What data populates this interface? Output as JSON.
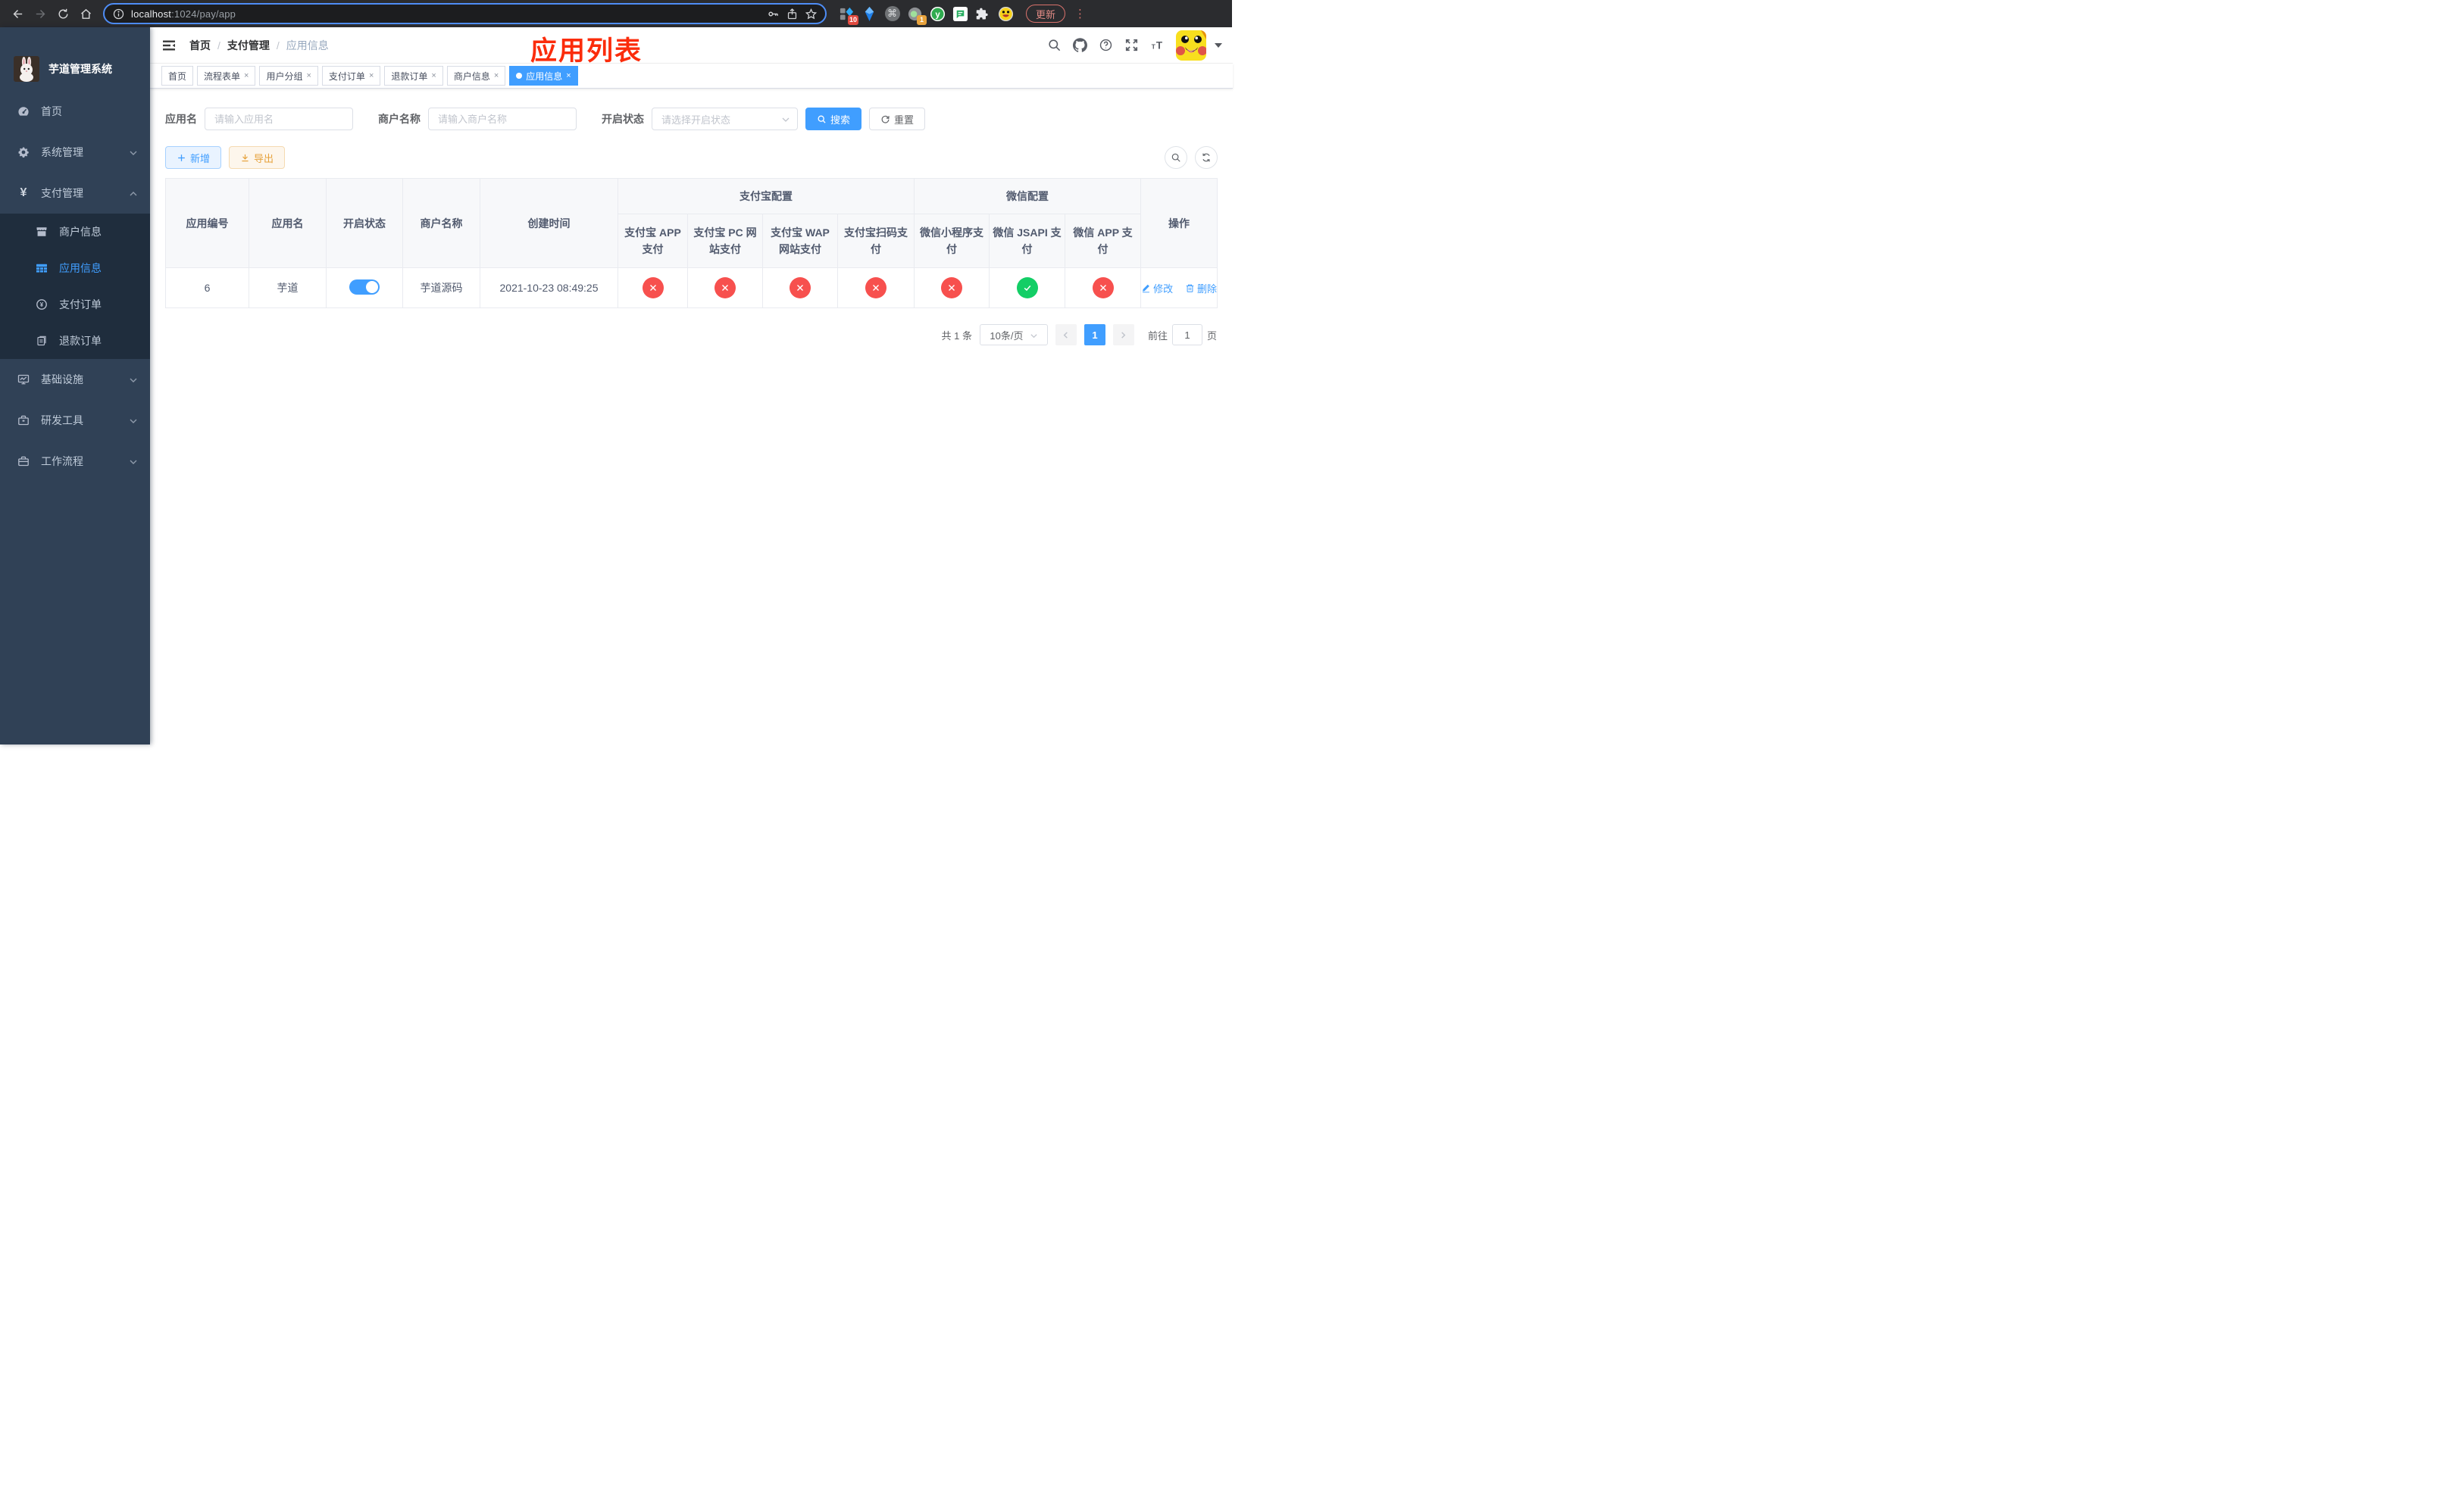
{
  "browser": {
    "url_host": "localhost",
    "url_rest": ":1024/pay/app",
    "ext_badge_blue": "10",
    "ext_badge_proxy": "1",
    "update_label": "更新",
    "menu_dots": "⋮"
  },
  "sidebar": {
    "title": "芋道管理系统",
    "items": [
      {
        "label": "首页",
        "icon": "dashboard-icon",
        "expandable": false
      },
      {
        "label": "系统管理",
        "icon": "gear-icon",
        "expandable": true
      },
      {
        "label": "支付管理",
        "icon": "yen-icon",
        "expandable": true,
        "expanded": true
      },
      {
        "label": "基础设施",
        "icon": "monitor-icon",
        "expandable": true
      },
      {
        "label": "研发工具",
        "icon": "toolbox-icon",
        "expandable": true
      },
      {
        "label": "工作流程",
        "icon": "briefcase-icon",
        "expandable": true
      }
    ],
    "submenu": [
      {
        "label": "商户信息",
        "icon": "shop-icon",
        "active": false
      },
      {
        "label": "应用信息",
        "icon": "grid-icon",
        "active": true
      },
      {
        "label": "支付订单",
        "icon": "coin-icon",
        "active": false
      },
      {
        "label": "退款订单",
        "icon": "document-icon",
        "active": false
      }
    ]
  },
  "navbar": {
    "breadcrumb": [
      "首页",
      "支付管理",
      "应用信息"
    ],
    "separator": "/",
    "annotation": "应用列表"
  },
  "tags": [
    {
      "label": "首页",
      "closable": false,
      "active": false
    },
    {
      "label": "流程表单",
      "closable": true,
      "active": false
    },
    {
      "label": "用户分组",
      "closable": true,
      "active": false
    },
    {
      "label": "支付订单",
      "closable": true,
      "active": false
    },
    {
      "label": "退款订单",
      "closable": true,
      "active": false
    },
    {
      "label": "商户信息",
      "closable": true,
      "active": false
    },
    {
      "label": "应用信息",
      "closable": true,
      "active": true
    }
  ],
  "close_glyph": "×",
  "filter": {
    "app_name_label": "应用名",
    "app_name_placeholder": "请输入应用名",
    "merchant_label": "商户名称",
    "merchant_placeholder": "请输入商户名称",
    "status_label": "开启状态",
    "status_placeholder": "请选择开启状态",
    "search_label": "搜索",
    "reset_label": "重置"
  },
  "toolbar": {
    "add_label": "新增",
    "export_label": "导出"
  },
  "table": {
    "col_app_id": "应用编号",
    "col_app_name": "应用名",
    "col_status": "开启状态",
    "col_merchant": "商户名称",
    "col_created": "创建时间",
    "group_alipay": "支付宝配置",
    "group_wechat": "微信配置",
    "col_alipay_app": "支付宝 APP 支付",
    "col_alipay_pc": "支付宝 PC 网站支付",
    "col_alipay_wap": "支付宝 WAP 网站支付",
    "col_alipay_qr": "支付宝扫码支付",
    "col_wx_mini": "微信小程序支付",
    "col_wx_jsapi": "微信 JSAPI 支付",
    "col_wx_app": "微信 APP 支付",
    "col_actions": "操作",
    "row": {
      "app_id": "6",
      "app_name": "芋道",
      "enabled": true,
      "merchant": "芋道源码",
      "created": "2021-10-23 08:49:25",
      "channel_status": [
        "disabled",
        "disabled",
        "disabled",
        "disabled",
        "disabled",
        "enabled",
        "disabled"
      ],
      "edit_label": "修改",
      "delete_label": "删除"
    }
  },
  "pagination": {
    "total_label": "共 1 条",
    "page_size_label": "10条/页",
    "current_page": "1",
    "goto_label": "前往",
    "goto_value": "1",
    "page_unit": "页"
  },
  "colors": {
    "primary": "#409eff",
    "success": "#13ce66",
    "danger": "#f7504e",
    "warning": "#e6a23c",
    "sidebar_bg": "#304156",
    "submenu_bg": "#1f2d3d",
    "annotation_red": "#fb2c0b"
  }
}
